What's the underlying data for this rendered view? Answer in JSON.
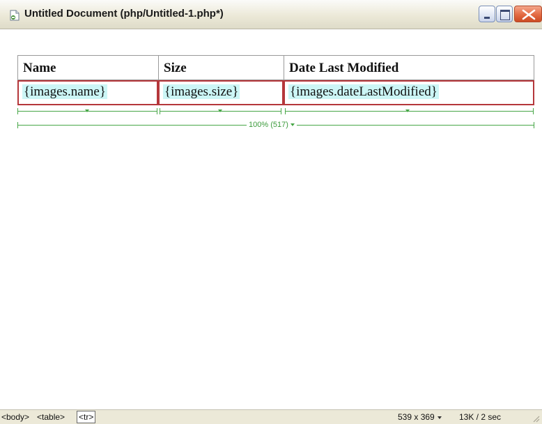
{
  "window": {
    "title": "Untitled Document (php/Untitled-1.php*)",
    "icon": "php-document-icon"
  },
  "table": {
    "headers": [
      "Name",
      "Size",
      "Date Last Modified"
    ],
    "row": [
      "{images.name}",
      "{images.size}",
      "{images.dateLastModified}"
    ]
  },
  "width_indicator": {
    "total": "100% (517)"
  },
  "statusbar": {
    "tags": [
      "<body>",
      "<table>",
      "<tr>"
    ],
    "selected_tag": "<tr>",
    "window_size": "539 x 369",
    "download": "13K / 2 sec"
  },
  "colors": {
    "dynamic_text_bg": "#ccf6f6",
    "selected_row_border": "#b5373b",
    "guide_green": "#46a646"
  }
}
